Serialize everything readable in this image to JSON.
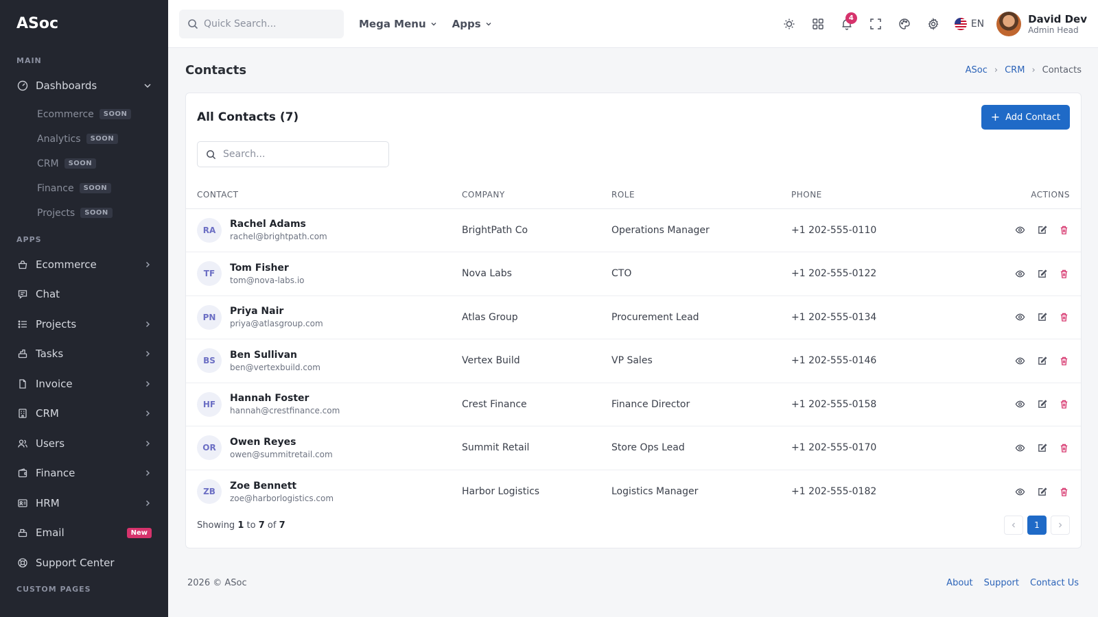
{
  "brand": "ASoc",
  "sidebar": {
    "main_title": "MAIN",
    "dashboards_label": "Dashboards",
    "dashboard_subitems": [
      {
        "label": "Ecommerce",
        "badge": "SOON"
      },
      {
        "label": "Analytics",
        "badge": "SOON"
      },
      {
        "label": "CRM",
        "badge": "SOON"
      },
      {
        "label": "Finance",
        "badge": "SOON"
      },
      {
        "label": "Projects",
        "badge": "SOON"
      }
    ],
    "apps_title": "APPS",
    "apps": [
      {
        "label": "Ecommerce",
        "icon": "shop-icon"
      },
      {
        "label": "Chat",
        "icon": "chat-icon"
      },
      {
        "label": "Projects",
        "icon": "list-icon"
      },
      {
        "label": "Tasks",
        "icon": "tasks-icon"
      },
      {
        "label": "Invoice",
        "icon": "file-icon"
      },
      {
        "label": "CRM",
        "icon": "building-icon"
      },
      {
        "label": "Users",
        "icon": "users-icon"
      },
      {
        "label": "Finance",
        "icon": "wallet-icon"
      },
      {
        "label": "HRM",
        "icon": "idcard-icon"
      },
      {
        "label": "Email",
        "icon": "mail-icon",
        "badge": "New"
      },
      {
        "label": "Support Center",
        "icon": "lifebuoy-icon"
      }
    ],
    "custom_title": "CUSTOM PAGES"
  },
  "topbar": {
    "search_placeholder": "Quick Search...",
    "mega_menu": "Mega Menu",
    "apps_menu": "Apps",
    "notif_count": "4",
    "language": "EN",
    "user_name": "David Dev",
    "user_role": "Admin Head"
  },
  "page": {
    "title": "Contacts",
    "breadcrumb": [
      "ASoc",
      "CRM",
      "Contacts"
    ]
  },
  "contacts": {
    "title": "All Contacts (7)",
    "add_button": "Add Contact",
    "search_placeholder": "Search...",
    "columns": [
      "CONTACT",
      "COMPANY",
      "ROLE",
      "PHONE",
      "ACTIONS"
    ],
    "rows": [
      {
        "initials": "RA",
        "name": "Rachel Adams",
        "email": "rachel@brightpath.com",
        "company": "BrightPath Co",
        "role": "Operations Manager",
        "phone": "+1 202-555-0110"
      },
      {
        "initials": "TF",
        "name": "Tom Fisher",
        "email": "tom@nova-labs.io",
        "company": "Nova Labs",
        "role": "CTO",
        "phone": "+1 202-555-0122"
      },
      {
        "initials": "PN",
        "name": "Priya Nair",
        "email": "priya@atlasgroup.com",
        "company": "Atlas Group",
        "role": "Procurement Lead",
        "phone": "+1 202-555-0134"
      },
      {
        "initials": "BS",
        "name": "Ben Sullivan",
        "email": "ben@vertexbuild.com",
        "company": "Vertex Build",
        "role": "VP Sales",
        "phone": "+1 202-555-0146"
      },
      {
        "initials": "HF",
        "name": "Hannah Foster",
        "email": "hannah@crestfinance.com",
        "company": "Crest Finance",
        "role": "Finance Director",
        "phone": "+1 202-555-0158"
      },
      {
        "initials": "OR",
        "name": "Owen Reyes",
        "email": "owen@summitretail.com",
        "company": "Summit Retail",
        "role": "Store Ops Lead",
        "phone": "+1 202-555-0170"
      },
      {
        "initials": "ZB",
        "name": "Zoe Bennett",
        "email": "zoe@harborlogistics.com",
        "company": "Harbor Logistics",
        "role": "Logistics Manager",
        "phone": "+1 202-555-0182"
      }
    ],
    "showing": {
      "prefix": "Showing",
      "from": "1",
      "to_word": "to",
      "to": "7",
      "of_word": "of",
      "total": "7"
    },
    "current_page": "1"
  },
  "footer": {
    "copyright": "2026 © ASoc",
    "links": [
      "About",
      "Support",
      "Contact Us"
    ]
  },
  "colors": {
    "sidebar_bg": "#23262f",
    "primary": "#1f6ac7",
    "danger": "#d6336c"
  }
}
